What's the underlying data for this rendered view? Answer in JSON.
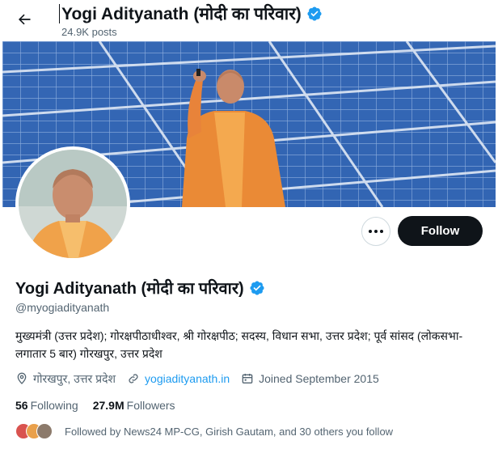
{
  "header": {
    "title": "Yogi Adityanath (मोदी का परिवार)",
    "posts_count": "24.9K posts"
  },
  "profile": {
    "name": "Yogi Adityanath (मोदी का परिवार)",
    "handle": "@myogiadityanath",
    "bio": "मुख्यमंत्री (उत्तर प्रदेश); गोरक्षपीठाधीश्वर, श्री गोरक्षपीठ; सदस्य, विधान सभा, उत्तर प्रदेश; पूर्व सांसद (लोकसभा-लगातार 5 बार) गोरखपुर, उत्तर प्रदेश",
    "location": "गोरखपुर, उत्तर प्रदेश",
    "website": "yogiadityanath.in",
    "joined": "Joined September 2015",
    "verified": true
  },
  "stats": {
    "following_count": "56",
    "following_label": "Following",
    "followers_count": "27.9M",
    "followers_label": "Followers"
  },
  "actions": {
    "follow_label": "Follow"
  },
  "followed_by": "Followed by News24 MP-CG, Girish Gautam, and 30 others you follow",
  "colors": {
    "accent": "#1d9bf0",
    "text": "#0f1419",
    "muted": "#536471",
    "follow_button": "#0f1419"
  },
  "icons": [
    "back-arrow-icon",
    "verified-badge-icon",
    "more-icon",
    "location-icon",
    "link-icon",
    "calendar-icon"
  ]
}
